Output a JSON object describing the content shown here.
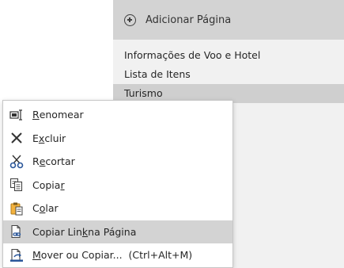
{
  "page_list": {
    "add_page_label": "Adicionar Página",
    "pages": [
      "Informações de Voo e Hotel",
      "Lista de Itens",
      "Turismo"
    ],
    "selected_page": "Turismo"
  },
  "context_menu": {
    "items": [
      {
        "pre": "",
        "accel": "R",
        "post": "enomear",
        "icon": "rename-icon"
      },
      {
        "pre": "E",
        "accel": "x",
        "post": "cluir",
        "icon": "delete-x-icon"
      },
      {
        "pre": "R",
        "accel": "e",
        "post": "cortar",
        "icon": "scissors-icon"
      },
      {
        "pre": "Copia",
        "accel": "r",
        "post": "",
        "icon": "copy-icon"
      },
      {
        "pre": "C",
        "accel": "o",
        "post": "lar",
        "icon": "paste-icon"
      },
      {
        "pre": "Copiar Lin",
        "accel": "k",
        "post": " na Página",
        "icon": "copy-link-icon"
      },
      {
        "pre": "",
        "accel": "M",
        "post": "over ou Copiar...  (Ctrl+Alt+M)",
        "icon": "move-copy-icon"
      }
    ],
    "highlighted_item": "Copiar Link na Página"
  },
  "colors": {
    "panel_bg": "#f1f1f1",
    "header_bg": "#d3d3d3",
    "selected_bg": "#cfcfcf",
    "menu_highlight": "#d3d3d3",
    "delete_icon": "#333333",
    "scissors_icon": "#2b579a",
    "paste_icon": "#f3b23d",
    "link_icon": "#2b579a"
  }
}
